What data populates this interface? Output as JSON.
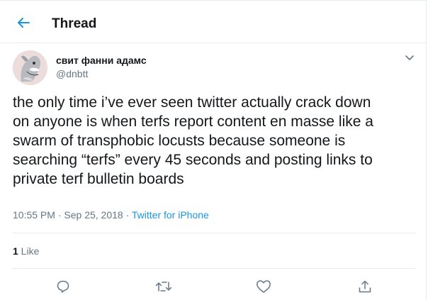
{
  "header": {
    "title": "Thread"
  },
  "tweet": {
    "display_name": "свит фанни адамс",
    "username": "@dnbtt",
    "text": "the only time i’ve ever seen twitter actually crack down\non anyone is when terfs report content en masse like a\nswarm of transphobic locusts because someone is\nsearching “terfs” every 45 seconds and posting links to\nprivate terf bulletin boards",
    "time": "10:55 PM",
    "separator": " · ",
    "date": "Sep 25, 2018",
    "source": "Twitter for iPhone",
    "likes_count": "1",
    "likes_label": " Like"
  },
  "colors": {
    "accent": "#1b95e0",
    "muted": "#657786",
    "text": "#14171a",
    "border": "#e6ecf0"
  },
  "icons": [
    "back-arrow-icon",
    "chevron-down-icon",
    "reply-icon",
    "retweet-icon",
    "like-icon",
    "share-icon"
  ]
}
